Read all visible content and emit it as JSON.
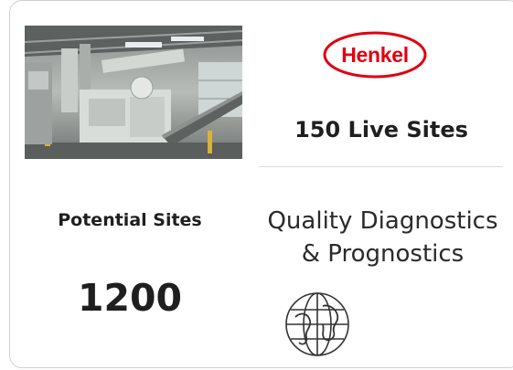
{
  "card": {
    "photo_name": "industrial-machinery-photo",
    "brand_logo": "Henkel",
    "live_sites": "150 Live Sites",
    "potential_label": "Potential Sites",
    "potential_value": "1200",
    "service_title_line1": "Quality Diagnostics",
    "service_title_line2": "& Prognostics",
    "icon": "globe-icon"
  },
  "colors": {
    "brand_red": "#e1000f",
    "text_dark": "#1f1f1f",
    "border": "#cfcfcf"
  }
}
